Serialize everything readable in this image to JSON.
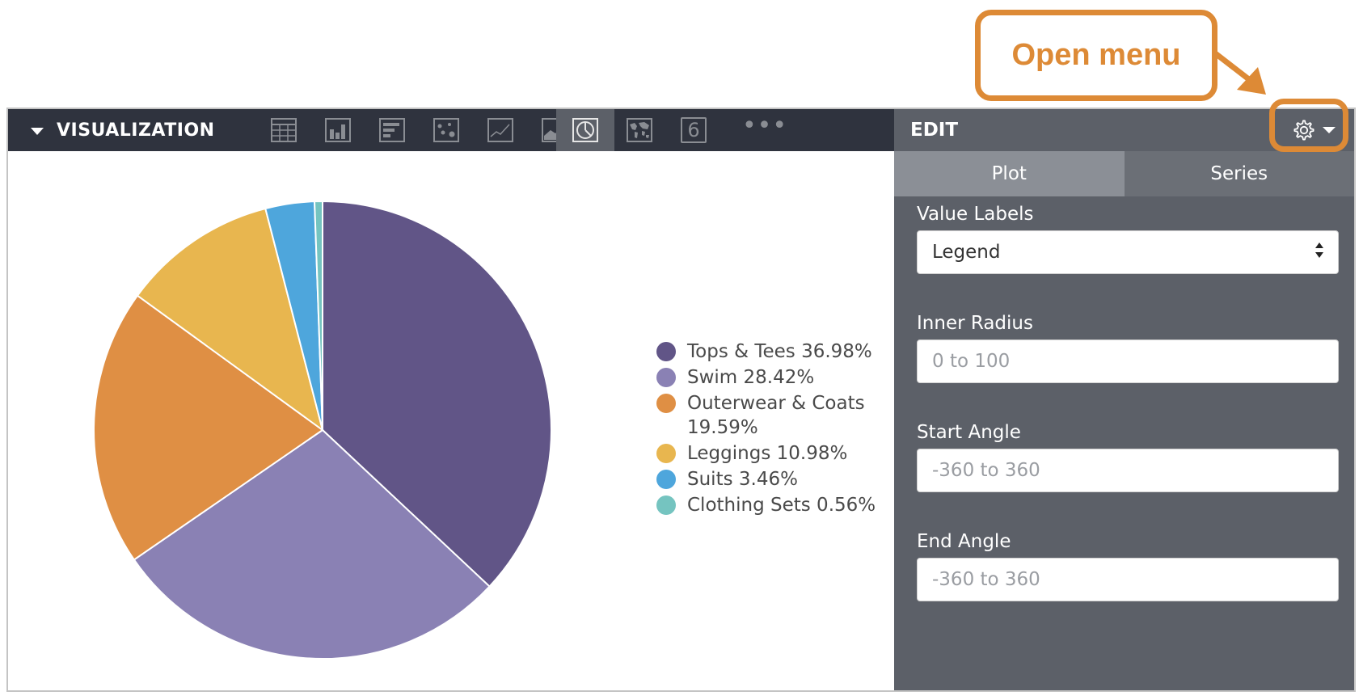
{
  "annotation": {
    "callout_text": "Open menu",
    "color": "#dd8a36"
  },
  "toolbar": {
    "title": "VISUALIZATION",
    "icons": [
      {
        "name": "table-icon"
      },
      {
        "name": "column-chart-icon"
      },
      {
        "name": "bar-chart-icon"
      },
      {
        "name": "scatter-chart-icon"
      },
      {
        "name": "line-chart-icon"
      },
      {
        "name": "area-chart-icon"
      },
      {
        "name": "pie-chart-icon",
        "active": true
      },
      {
        "name": "map-icon"
      },
      {
        "name": "single-value-icon",
        "label": "6"
      },
      {
        "name": "more-icon",
        "label": "•••"
      }
    ]
  },
  "edit_panel": {
    "title": "EDIT",
    "gear_icon": "gear-icon",
    "tabs": [
      {
        "label": "Plot",
        "active": true
      },
      {
        "label": "Series",
        "active": false
      }
    ],
    "fields": {
      "value_labels": {
        "label": "Value Labels",
        "value": "Legend"
      },
      "inner_radius": {
        "label": "Inner Radius",
        "placeholder": "0 to 100"
      },
      "start_angle": {
        "label": "Start Angle",
        "placeholder": "-360 to 360"
      },
      "end_angle": {
        "label": "End Angle",
        "placeholder": "-360 to 360"
      }
    }
  },
  "chart_data": {
    "type": "pie",
    "categories": [
      "Tops & Tees",
      "Swim",
      "Outerwear & Coats",
      "Leggings",
      "Suits",
      "Clothing Sets"
    ],
    "values": [
      36.98,
      28.42,
      19.59,
      10.98,
      3.46,
      0.56
    ],
    "colors": [
      "#615587",
      "#8a81b4",
      "#df8f44",
      "#e8b64f",
      "#4ea6dc",
      "#75c4c0"
    ],
    "legend_labels": [
      "Tops & Tees 36.98%",
      "Swim 28.42%",
      "Outerwear & Coats",
      "Leggings 10.98%",
      "Suits 3.46%",
      "Clothing Sets 0.56%"
    ],
    "legend_label_2": "19.59%",
    "legend_position": "right"
  }
}
